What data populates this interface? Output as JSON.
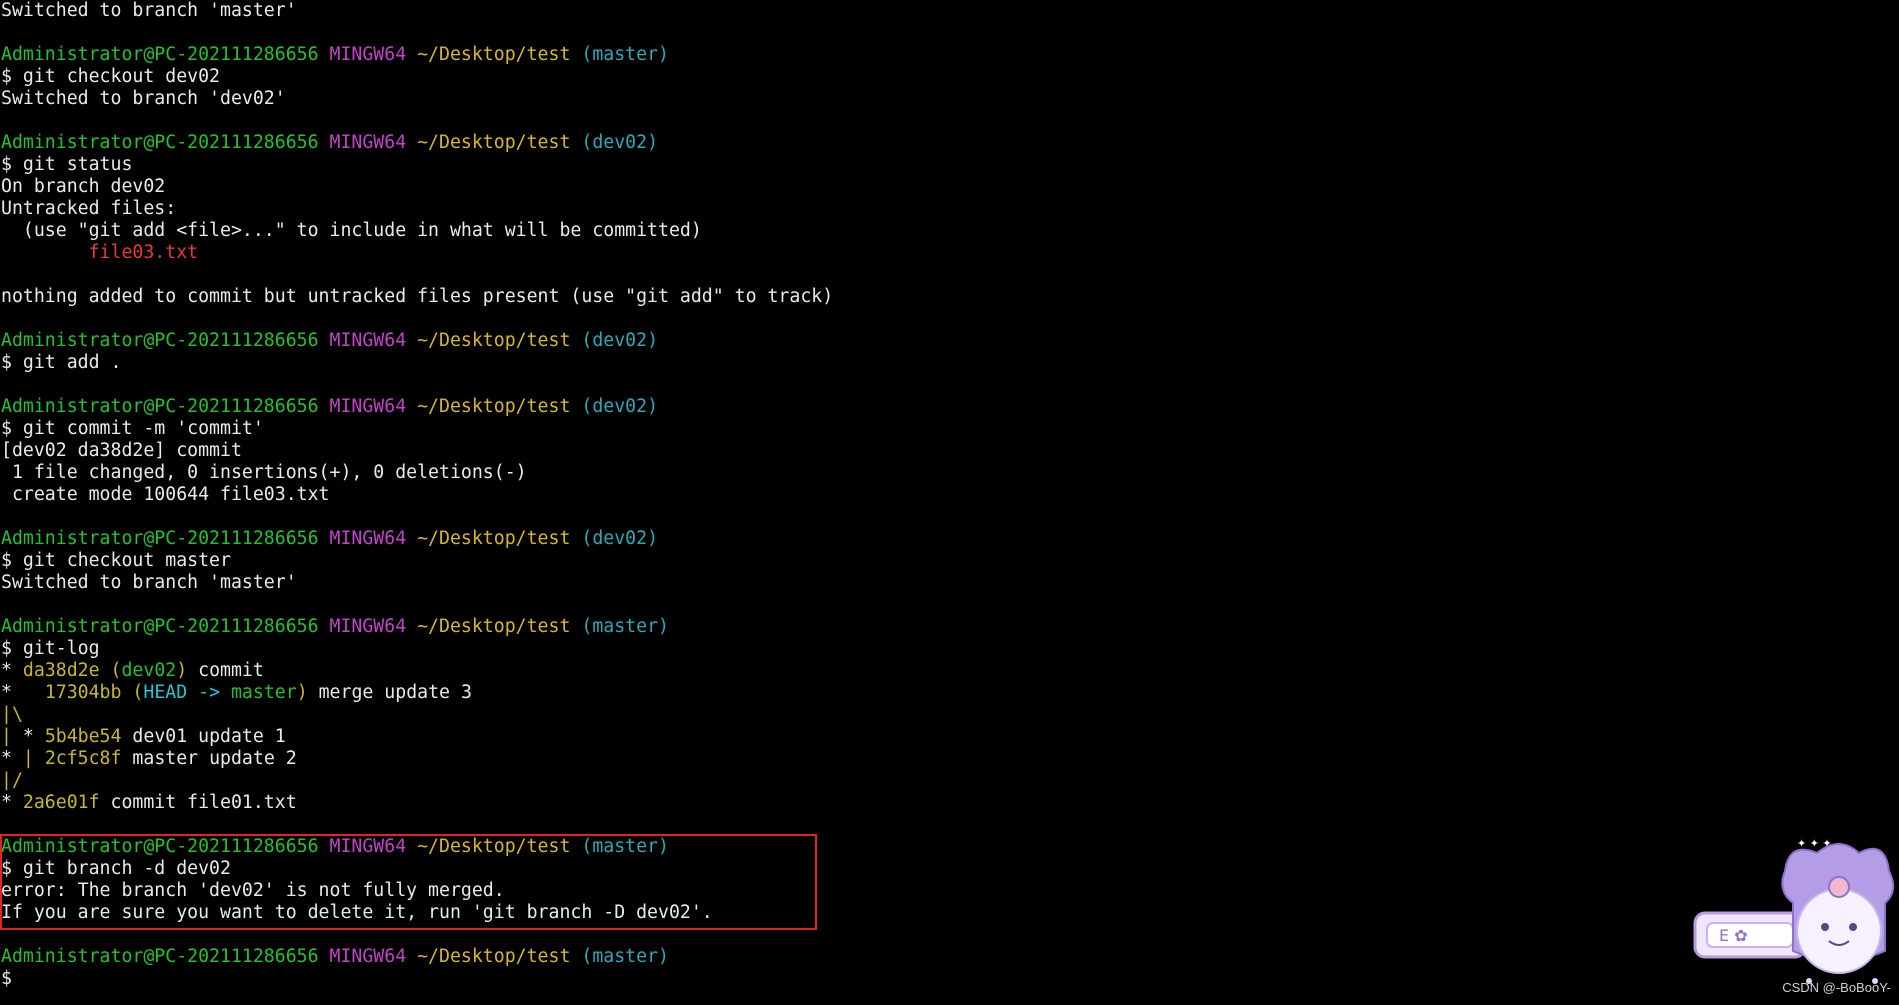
{
  "prompt": {
    "user": "Administrator@PC-202111286656",
    "system": "MINGW64",
    "path": "~/Desktop/test",
    "dollar": "$"
  },
  "lines": {
    "l0": "Switched to branch 'master'",
    "b1": "(master)",
    "c1": "$ git checkout dev02",
    "o1": "Switched to branch 'dev02'",
    "b2": "(dev02)",
    "c2": "$ git status",
    "o2a": "On branch dev02",
    "o2b": "Untracked files:",
    "o2c": "  (use \"git add <file>...\" to include in what will be committed)",
    "o2d": "        file03.txt",
    "o2e": "nothing added to commit but untracked files present (use \"git add\" to track)",
    "b3": "(dev02)",
    "c3": "$ git add .",
    "b4": "(dev02)",
    "c4": "$ git commit -m 'commit'",
    "o4a": "[dev02 da38d2e] commit",
    "o4b": " 1 file changed, 0 insertions(+), 0 deletions(-)",
    "o4c": " create mode 100644 file03.txt",
    "b5": "(dev02)",
    "c5": "$ git checkout master",
    "o5": "Switched to branch 'master'",
    "b6": "(master)",
    "c6": "$ git-log",
    "b7": "(master)",
    "c7": "$ git branch -d dev02",
    "o7a": "error: The branch 'dev02' is not fully merged.",
    "o7b": "If you are sure you want to delete it, run 'git branch -D dev02'.",
    "b8": "(master)",
    "c8": "$"
  },
  "gitlog": {
    "r1": {
      "star": "* ",
      "hash": "da38d2e",
      "ref_open": " (",
      "ref": "dev02",
      "ref_close": ")",
      "msg": " commit"
    },
    "r2": {
      "star": "*   ",
      "hash": "17304bb",
      "ref_open": " (",
      "head": "HEAD -> ",
      "ref": "master",
      "ref_close": ")",
      "msg": " merge update 3"
    },
    "r3": {
      "graph": "|\\"
    },
    "r4": {
      "pipe": "| ",
      "star": "* ",
      "hash": "5b4be54",
      "msg": " dev01 update 1"
    },
    "r5": {
      "star": "* ",
      "pipe": "| ",
      "hash": "2cf5c8f",
      "msg": " master update 2"
    },
    "r6": {
      "graph": "|/"
    },
    "r7": {
      "star": "* ",
      "hash": "2a6e01f",
      "msg": " commit file01.txt"
    }
  },
  "watermark": {
    "text": "CSDN @-BoBooY-"
  },
  "colors": {
    "background": "#000000",
    "user": "#23c12f",
    "system": "#c043c8",
    "path": "#d7b72a",
    "branch": "#2ca9b8",
    "untracked_file": "#e23a3a",
    "highlight_border": "#e02424"
  }
}
